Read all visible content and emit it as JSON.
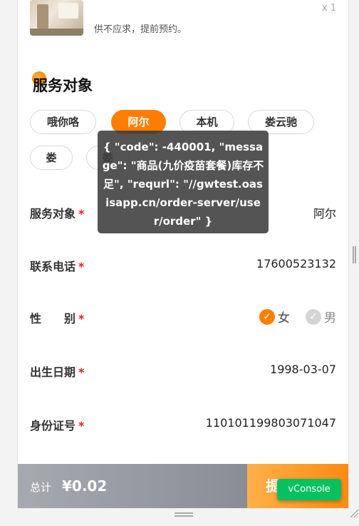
{
  "product": {
    "description": "供不应求，提前预约。",
    "quantity": "x 1"
  },
  "section": {
    "title": "服务对象"
  },
  "chips": [
    {
      "label": "哦你咯",
      "active": false
    },
    {
      "label": "阿尔",
      "active": true
    },
    {
      "label": "本机",
      "active": false
    },
    {
      "label": "娄云驰",
      "active": false
    },
    {
      "label": "娄",
      "active": false
    },
    {
      "label": "娄",
      "active": false
    }
  ],
  "form": {
    "service_target": {
      "label": "服务对象",
      "required": "*",
      "value": "阿尔"
    },
    "phone": {
      "label": "联系电话",
      "required": "*",
      "value": "17600523132"
    },
    "gender": {
      "label": "性　　别",
      "required": "*",
      "female": "女",
      "male": "男",
      "selected": "女"
    },
    "birth": {
      "label": "出生日期",
      "required": "*",
      "value": "1998-03-07"
    },
    "id_number": {
      "label": "身份证号",
      "required": "*",
      "value": "110101199803071047"
    }
  },
  "bottom_bar": {
    "total_label": "总计",
    "amount": "¥0.02",
    "submit_label": "提"
  },
  "vconsole_label": "vConsole",
  "toast": {
    "text": "{ \"code\": -440001, \"message\": \"商品(九价疫苗套餐)库存不足\", \"requrl\": \"//gwtest.oasisapp.cn/order-server/user/order\" }"
  },
  "colors": {
    "accent": "#ff7e00",
    "required": "#e2231a",
    "vconsole": "#07c160"
  }
}
